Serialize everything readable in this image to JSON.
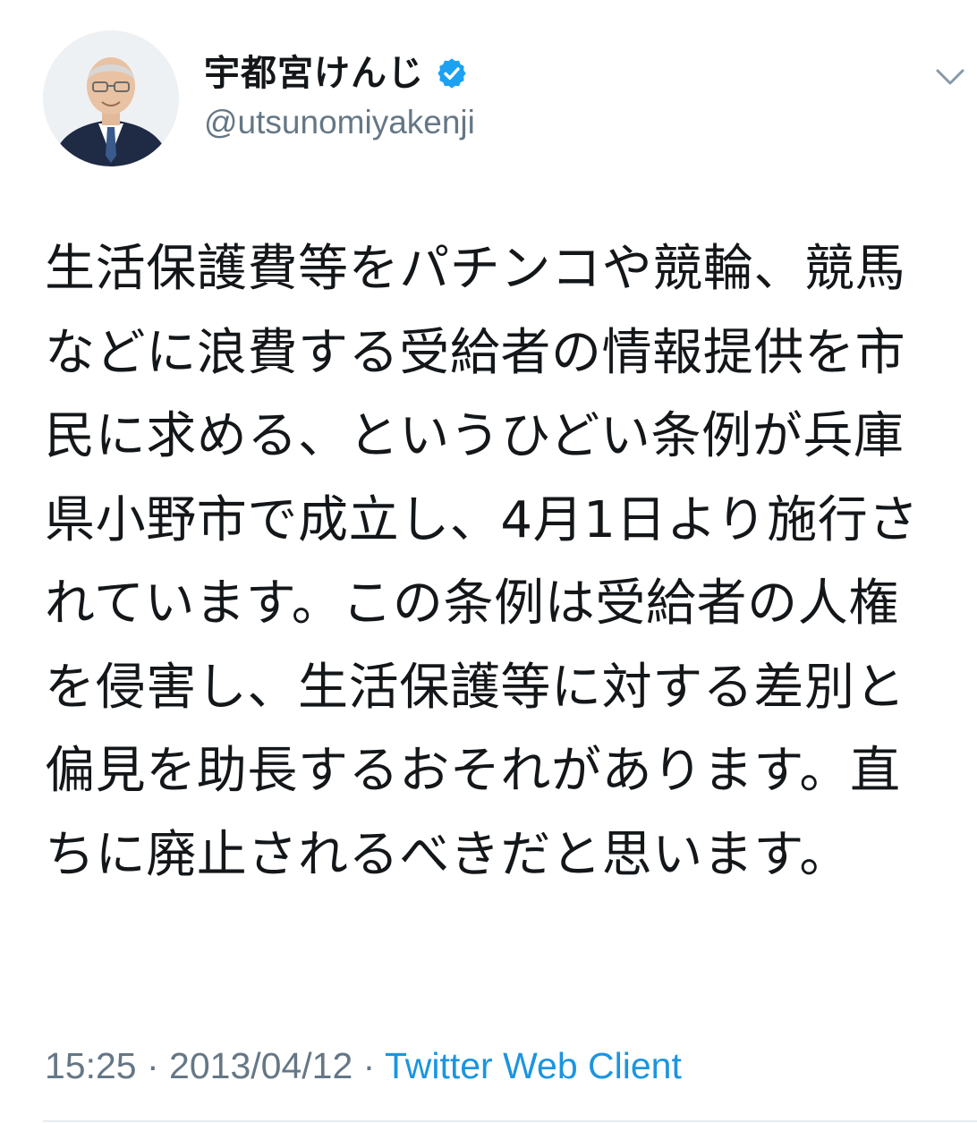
{
  "user": {
    "display_name": "宇都宮けんじ",
    "handle": "@utsunomiyakenji",
    "verified": true
  },
  "tweet": {
    "text": "生活保護費等をパチンコや競輪、競馬などに浪費する受給者の情報提供を市民に求める、というひどい条例が兵庫県小野市で成立し、4月1日より施行されています。この条例は受給者の人権を侵害し、生活保護等に対する差別と偏見を助長するおそれがあります。直ちに廃止されるべきだと思います。",
    "time": "15:25",
    "separator1": " · ",
    "date": "2013/04/12",
    "separator2": " · ",
    "source": "Twitter Web Client"
  },
  "icons": {
    "verified": "verified-badge-icon",
    "menu": "chevron-down-icon"
  },
  "colors": {
    "text": "#14171a",
    "secondary": "#657786",
    "link": "#1b95e0",
    "verified": "#1da1f2"
  }
}
